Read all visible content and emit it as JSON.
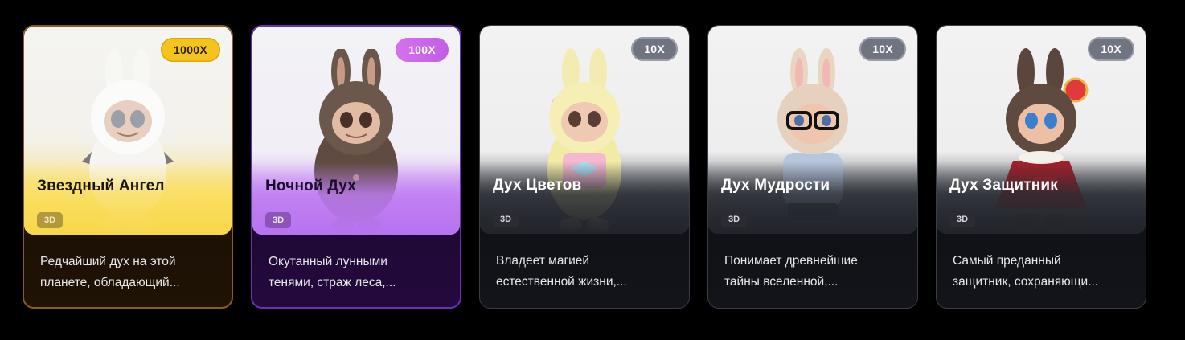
{
  "cards": [
    {
      "badge": "1000X",
      "title": "Звездный Ангел",
      "tag": "3D",
      "desc_line1": "Редчайший дух на этой",
      "desc_line2": "планете, обладающий..."
    },
    {
      "badge": "100X",
      "title": "Ночной Дух",
      "tag": "3D",
      "desc_line1": "Окутанный лунными",
      "desc_line2": "тенями, страж леса,..."
    },
    {
      "badge": "10X",
      "title": "Дух Цветов",
      "tag": "3D",
      "desc_line1": "Владеет магией",
      "desc_line2": "естественной жизни,..."
    },
    {
      "badge": "10X",
      "title": "Дух Мудрости",
      "tag": "3D",
      "desc_line1": "Понимает древнейшие",
      "desc_line2": "тайны вселенной,..."
    },
    {
      "badge": "10X",
      "title": "Дух Защитник",
      "tag": "3D",
      "desc_line1": "Самый преданный",
      "desc_line2": "защитник, сохраняющи..."
    }
  ],
  "colors": {
    "gold_accent": "#f5c31d",
    "purple_accent": "#c25de6",
    "gray_accent": "#6f7480",
    "background": "#000000"
  }
}
